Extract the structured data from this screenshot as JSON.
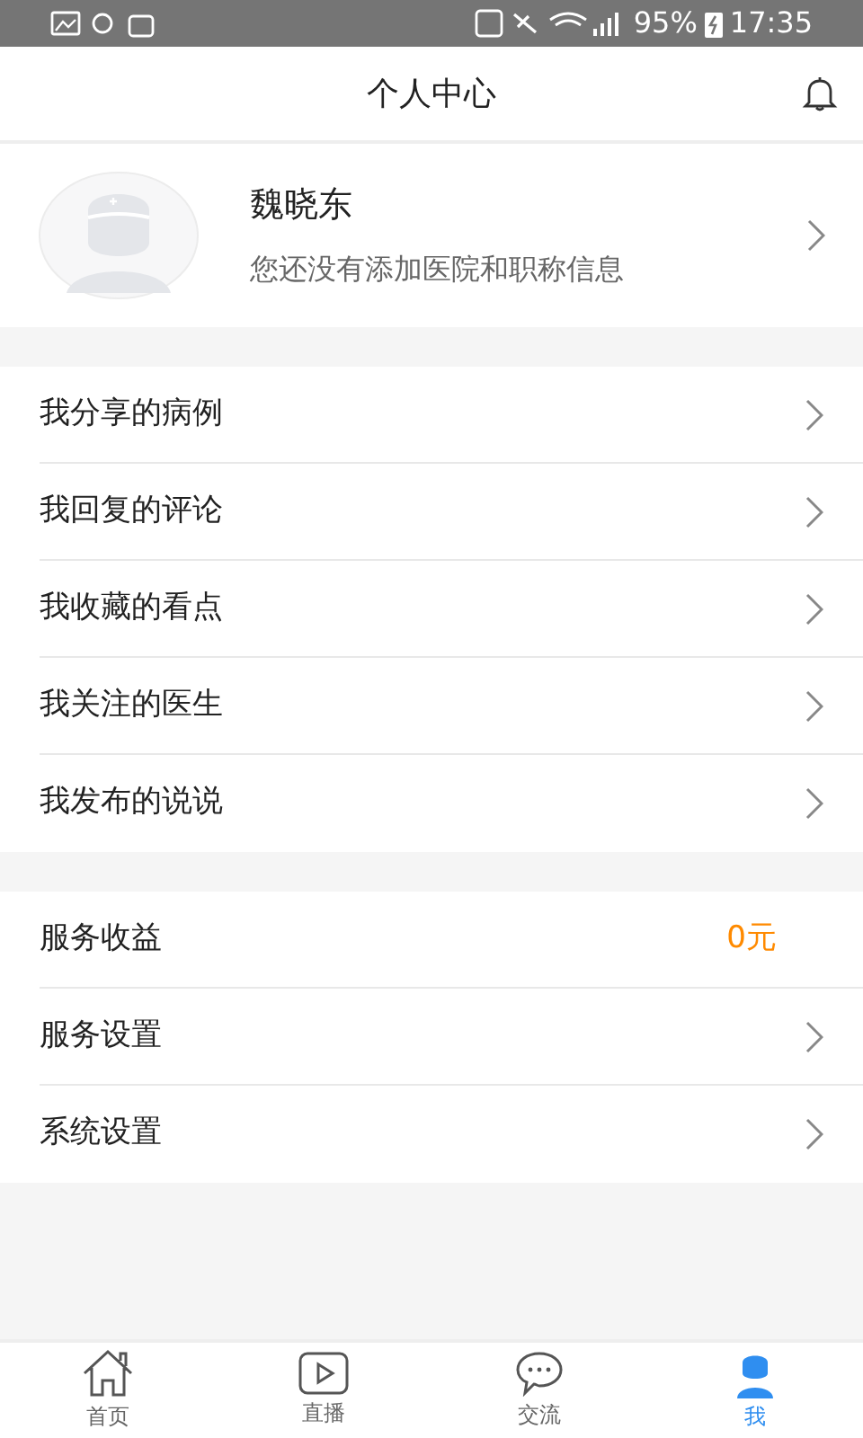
{
  "status_bar": {
    "battery": "95%",
    "time": "17:35"
  },
  "header": {
    "title": "个人中心"
  },
  "profile": {
    "name": "魏晓东",
    "subtitle": "您还没有添加医院和职称信息"
  },
  "menu_groups": [
    {
      "items": [
        {
          "kind": "link",
          "label": "我分享的病例"
        },
        {
          "kind": "link",
          "label": "我回复的评论"
        },
        {
          "kind": "link",
          "label": "我收藏的看点"
        },
        {
          "kind": "link",
          "label": "我关注的医生"
        },
        {
          "kind": "link",
          "label": "我发布的说说"
        }
      ]
    },
    {
      "items": [
        {
          "kind": "value",
          "label": "服务收益",
          "value": "0元"
        },
        {
          "kind": "link",
          "label": "服务设置"
        },
        {
          "kind": "link",
          "label": "系统设置"
        }
      ]
    }
  ],
  "tab_bar": [
    {
      "kind": "home",
      "label": "首页",
      "selected": false
    },
    {
      "kind": "video",
      "label": "直播",
      "selected": false
    },
    {
      "kind": "chat",
      "label": "交流",
      "selected": false
    },
    {
      "kind": "me",
      "label": "我",
      "selected": true
    }
  ]
}
